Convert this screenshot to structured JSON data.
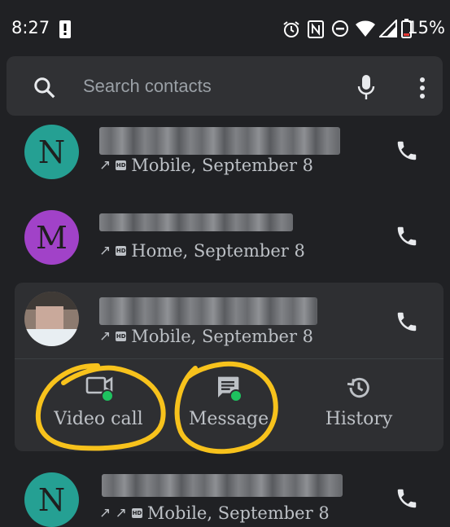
{
  "status_bar": {
    "time": "8:27",
    "battery": "15%"
  },
  "search": {
    "placeholder": "Search contacts"
  },
  "contacts": [
    {
      "avatar_letter": "N",
      "avatar_color": "#25a093",
      "call_type": "↗",
      "detail": "Mobile, September 8"
    },
    {
      "avatar_letter": "M",
      "avatar_color": "#a142c8",
      "call_type": "↗",
      "detail": "Home, September 8"
    },
    {
      "avatar_letter": "",
      "call_type": "↗",
      "detail": "Mobile, September 8",
      "expanded": true
    },
    {
      "avatar_letter": "N",
      "avatar_color": "#25a093",
      "call_type": "↗ ↗",
      "detail": "Mobile, September 8"
    }
  ],
  "actions": [
    {
      "label": "Video call",
      "icon": "video-call-icon"
    },
    {
      "label": "Message",
      "icon": "message-icon"
    },
    {
      "label": "History",
      "icon": "history-icon"
    }
  ],
  "colors": {
    "background": "#202124",
    "annotation": "#f7c21c",
    "presence": "#1ec25f"
  }
}
